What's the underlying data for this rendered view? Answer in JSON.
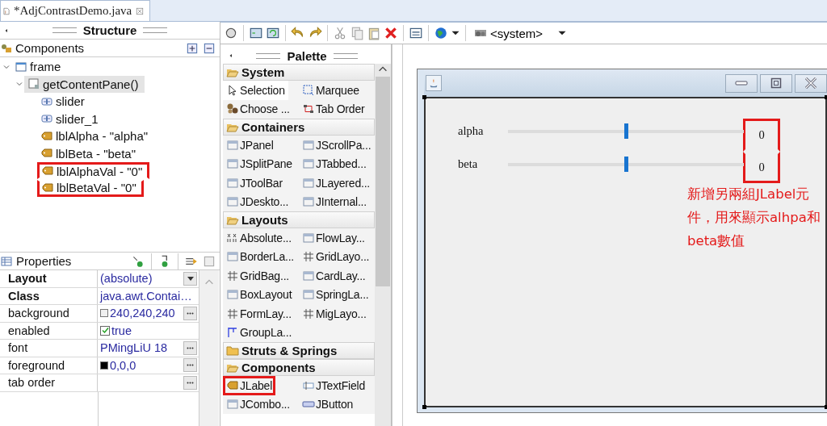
{
  "editor_tab": {
    "title": "*AdjContrastDemo.java",
    "selected": true
  },
  "structure": {
    "title": "Structure",
    "components_title": "Components",
    "tree": [
      {
        "label": "frame",
        "kind": "frame",
        "expanded": true,
        "selected": false,
        "highlighted": false,
        "children": [
          {
            "label": "getContentPane()",
            "kind": "panel",
            "expanded": true,
            "selected": true,
            "highlighted": false,
            "children": [
              {
                "label": "slider",
                "kind": "slider",
                "selected": false,
                "highlighted": false
              },
              {
                "label": "slider_1",
                "kind": "slider",
                "selected": false,
                "highlighted": false
              },
              {
                "label": "lblAlpha - \"alpha\"",
                "kind": "label",
                "selected": false,
                "highlighted": false
              },
              {
                "label": "lblBeta - \"beta\"",
                "kind": "label",
                "selected": false,
                "highlighted": false
              },
              {
                "label": "lblAlphaVal - \"0\"",
                "kind": "label",
                "selected": false,
                "highlighted": true
              },
              {
                "label": "lblBetaVal - \"0\"",
                "kind": "label",
                "selected": false,
                "highlighted": true
              }
            ]
          }
        ]
      }
    ]
  },
  "properties": {
    "title": "Properties",
    "rows": [
      {
        "name": "Layout",
        "bold": true,
        "kind": "dropdown",
        "value": "(absolute)"
      },
      {
        "name": "Class",
        "bold": true,
        "kind": "text",
        "value": "java.awt.Contai…"
      },
      {
        "name": "background",
        "bold": false,
        "kind": "color",
        "value": "240,240,240",
        "color": "#f0f0f0"
      },
      {
        "name": "enabled",
        "bold": false,
        "kind": "checkbox",
        "value": "true",
        "checked": true
      },
      {
        "name": "font",
        "bold": false,
        "kind": "more",
        "value": "PMingLiU 18"
      },
      {
        "name": "foreground",
        "bold": false,
        "kind": "color",
        "value": "0,0,0",
        "color": "#000000"
      },
      {
        "name": "tab order",
        "bold": false,
        "kind": "more"
      }
    ]
  },
  "toolbar": {
    "runtime": "<system>"
  },
  "palette": {
    "title": "Palette",
    "categories": [
      {
        "name": "System",
        "expanded": true,
        "items": [
          {
            "label": "Selection",
            "selected": true,
            "highlighted": false
          },
          {
            "label": "Marquee",
            "selected": false,
            "highlighted": false
          },
          {
            "label": "Choose ...",
            "selected": false,
            "highlighted": false
          },
          {
            "label": "Tab Order",
            "selected": false,
            "highlighted": false
          }
        ]
      },
      {
        "name": "Containers",
        "expanded": true,
        "items": [
          {
            "label": "JPanel",
            "selected": false,
            "highlighted": false
          },
          {
            "label": "JScrollPa...",
            "selected": false,
            "highlighted": false
          },
          {
            "label": "JSplitPane",
            "selected": false,
            "highlighted": false
          },
          {
            "label": "JTabbed...",
            "selected": false,
            "highlighted": false
          },
          {
            "label": "JToolBar",
            "selected": false,
            "highlighted": false
          },
          {
            "label": "JLayered...",
            "selected": false,
            "highlighted": false
          },
          {
            "label": "JDeskto...",
            "selected": false,
            "highlighted": false
          },
          {
            "label": "JInternal...",
            "selected": false,
            "highlighted": false
          }
        ]
      },
      {
        "name": "Layouts",
        "expanded": true,
        "items": [
          {
            "label": "Absolute...",
            "selected": false,
            "highlighted": false
          },
          {
            "label": "FlowLay...",
            "selected": false,
            "highlighted": false
          },
          {
            "label": "BorderLa...",
            "selected": false,
            "highlighted": false
          },
          {
            "label": "GridLayo...",
            "selected": false,
            "highlighted": false
          },
          {
            "label": "GridBag...",
            "selected": false,
            "highlighted": false
          },
          {
            "label": "CardLay...",
            "selected": false,
            "highlighted": false
          },
          {
            "label": "BoxLayout",
            "selected": false,
            "highlighted": false
          },
          {
            "label": "SpringLa...",
            "selected": false,
            "highlighted": false
          },
          {
            "label": "FormLay...",
            "selected": false,
            "highlighted": false
          },
          {
            "label": "MigLayo...",
            "selected": false,
            "highlighted": false
          },
          {
            "label": "GroupLa...",
            "selected": false,
            "highlighted": false
          }
        ]
      },
      {
        "name": "Struts & Springs",
        "expanded": false
      },
      {
        "name": "Components",
        "expanded": true,
        "items": [
          {
            "label": "JLabel",
            "selected": false,
            "highlighted": true
          },
          {
            "label": "JTextField",
            "selected": false,
            "highlighted": false
          },
          {
            "label": "JCombo...",
            "selected": false,
            "highlighted": false
          },
          {
            "label": "JButton",
            "selected": false,
            "highlighted": false
          }
        ]
      }
    ]
  },
  "design": {
    "rows": [
      {
        "label": "alpha",
        "level": 0.5,
        "value": "0",
        "highlighted": true
      },
      {
        "label": "beta",
        "level": 0.5,
        "value": "0",
        "highlighted": true
      }
    ],
    "annotation": "新增另兩組JLabel元件，用來顯示alhpa和beta數值"
  }
}
